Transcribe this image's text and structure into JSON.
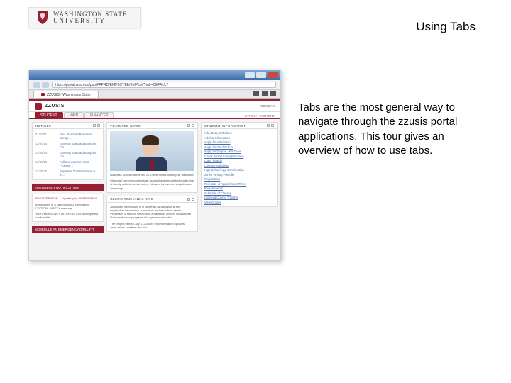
{
  "header": {
    "university_line1": "WASHINGTON STATE",
    "university_line2": "UNIVERSITY",
    "slide_title": "Using Tabs"
  },
  "description": "Tabs are the most general way to navigate through the zzusis portal applications. This tour gives an overview of how to use tabs.",
  "browser": {
    "url": "https://portal.wsu.edu/psp/PAPRD/EMPLOYEE/EMPL/h/?tab=DEFAULT",
    "tab_label": "ZZUSIS - Washington State"
  },
  "portal": {
    "brand": "ZZUSIS",
    "user_label": "COUGAR",
    "nav_tabs": [
      "STUDENT",
      "MAIN",
      "FINANCES"
    ],
    "right_links": [
      "LAYOUT",
      "CONTENT"
    ]
  },
  "notices": {
    "title": "NOTICES",
    "items": [
      {
        "date": "01/10/11",
        "text": "Dev, Standard Resumes Compr…"
      },
      {
        "date": "12/20/10",
        "text": "Entering Standard Blueprint Cou…"
      },
      {
        "date": "12/19/10",
        "text": "Entering Standard Blueprint Cou…"
      },
      {
        "date": "12/10/10",
        "text": "Fall and Summer 2010 Process…"
      },
      {
        "date": "11/30/10",
        "text": "Important Transfer Items in th…"
      }
    ]
  },
  "emergency": {
    "heading": "EMERGENCY NOTIFICATION",
    "body1": "REGISTER NOW — Update your EMERGENCY",
    "body2": "In the event of a campus WSU emergency CRITICAL SAFETY message.",
    "body3": "Your EMERGENCY NOTIFICATION is completely confidential.",
    "footer": "SCHEDULE AN EMERGENCY DRILL FIT"
  },
  "news": {
    "title": "FEATURED NEWS",
    "caption": "Business school names two 2010 Instructors of the year distinction",
    "body": "Memorial commemorated staff across the distinguished leadership & faculty achievements review, followed by awards reception and ceremony."
  },
  "timeline": {
    "title": "ZZUSIS TIMELINE & INFO",
    "body": "All student information is in domestic all admissions and registration information, transcripts and records in zzusis. Processes & student services in a transition occurs, includes the Pullman Access programs all payments activation.",
    "note": "The project behind July 1, 2010 its implementation updates www.zzusis-updates.wsu.edu"
  },
  "studentinfo": {
    "title": "STUDENT INFORMATION",
    "links": [
      "Add, Drop, Withdraw",
      "Advisor Information",
      "Apply for Admission",
      "Apply for Grad School",
      "Apply for Degree - Bachelor",
      "Check 2nd Yr Live Application",
      "Class Search",
      "Course Availability",
      "High School App Confirmation",
      "Junior Writing Portfolio",
      "Registration",
      "Reinstate or Appointment Times",
      "Requirements",
      "Schedule of Classes",
      "Unlinked Course Transfer",
      "View Grades"
    ]
  }
}
